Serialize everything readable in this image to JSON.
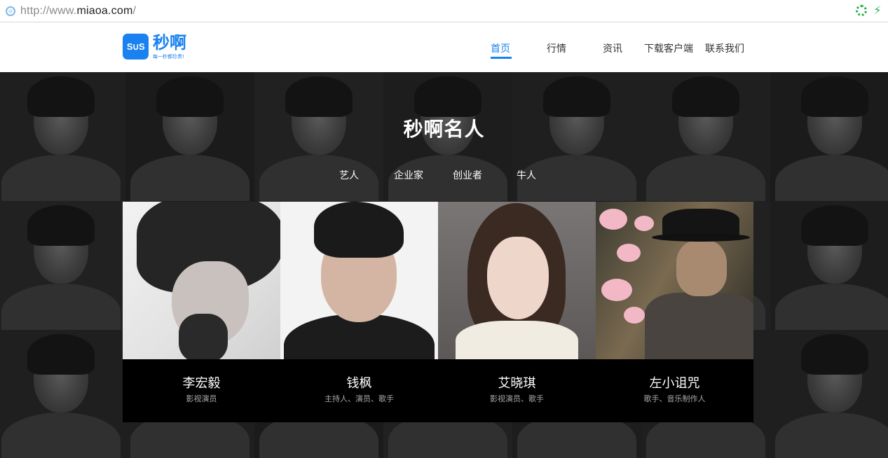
{
  "browser": {
    "url_scheme": "http://www.",
    "url_host": "miaoa.com",
    "url_path": "/"
  },
  "logo": {
    "badge": "S∪S",
    "name": "秒啊",
    "slogan": "每一秒都珍贵!"
  },
  "nav": {
    "items": [
      {
        "label": "首页",
        "active": true
      },
      {
        "label": "行情",
        "active": false
      },
      {
        "label": "资讯",
        "active": false
      },
      {
        "label": "下载客户端",
        "active": false
      },
      {
        "label": "联系我们",
        "active": false
      }
    ]
  },
  "hero": {
    "title": "秒啊名人",
    "tabs": [
      {
        "label": "艺人"
      },
      {
        "label": "企业家"
      },
      {
        "label": "创业者"
      },
      {
        "label": "牛人"
      }
    ]
  },
  "celebrities": [
    {
      "name": "李宏毅",
      "role": "影视演员"
    },
    {
      "name": "钱枫",
      "role": "主持人、演员、歌手"
    },
    {
      "name": "艾晓琪",
      "role": "影视演员、歌手"
    },
    {
      "name": "左小诅咒",
      "role": "歌手、音乐制作人"
    }
  ],
  "colors": {
    "brand": "#1a82f0",
    "hero_bg": "#262626",
    "card_bg": "#000000"
  }
}
